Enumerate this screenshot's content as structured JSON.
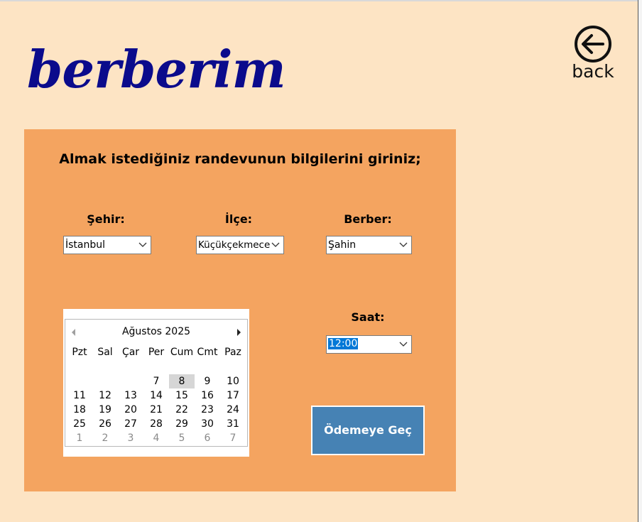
{
  "app": {
    "logo_text": "berberim",
    "back_label": "back"
  },
  "form": {
    "heading": "Almak istediğiniz randevunun bilgilerini giriniz;",
    "city": {
      "label": "Şehir:",
      "value": "İstanbul"
    },
    "district": {
      "label": "İlçe:",
      "value": "Küçükçekmece"
    },
    "barber": {
      "label": "Berber:",
      "value": "Şahin"
    },
    "time": {
      "label": "Saat:",
      "value": "12:00"
    },
    "pay_button": "Ödemeye Geç"
  },
  "calendar": {
    "month_label": "Ağustos 2025",
    "weekdays": [
      "Pzt",
      "Sal",
      "Çar",
      "Per",
      "Cum",
      "Cmt",
      "Paz"
    ],
    "selected_day": "8",
    "weeks": [
      [
        null,
        null,
        null,
        "7",
        "8",
        "9",
        "10"
      ],
      [
        "11",
        "12",
        "13",
        "14",
        "15",
        "16",
        "17"
      ],
      [
        "18",
        "19",
        "20",
        "21",
        "22",
        "23",
        "24"
      ],
      [
        "25",
        "26",
        "27",
        "28",
        "29",
        "30",
        "31"
      ],
      [
        "1",
        "2",
        "3",
        "4",
        "5",
        "6",
        "7"
      ]
    ],
    "next_month_row": 4
  },
  "colors": {
    "background": "#fde4c4",
    "panel": "#f4a460",
    "logo": "#0b0b8c",
    "button": "#4682b4",
    "selection": "#0078d7"
  },
  "icons": {
    "back": "circle-arrow-left-icon",
    "prev": "triangle-left-icon",
    "next": "triangle-right-icon",
    "dropdown": "chevron-down-icon"
  }
}
